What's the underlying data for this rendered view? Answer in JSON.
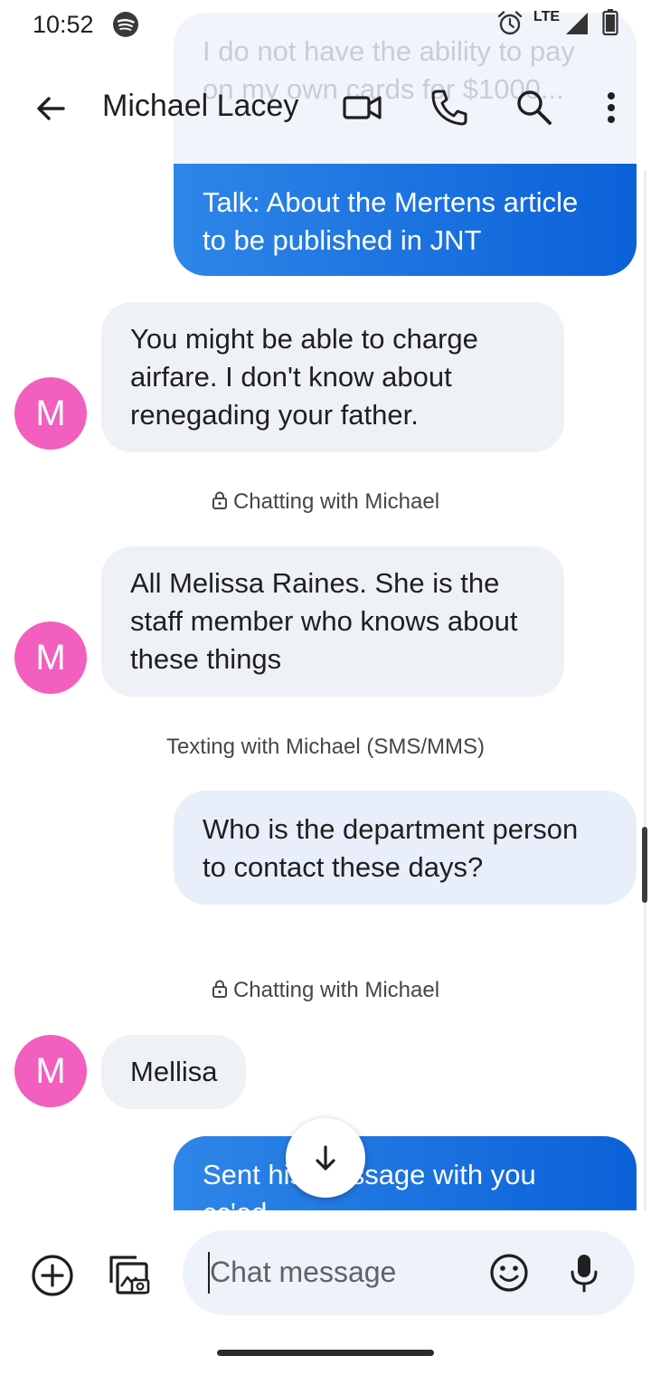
{
  "status_bar": {
    "time": "10:52",
    "network": "LTE",
    "icons": [
      "spotify-icon",
      "alarm-icon",
      "signal-icon",
      "battery-icon"
    ]
  },
  "header": {
    "contact_name": "Michael Lacey",
    "actions": [
      "back-arrow-icon",
      "video-call-icon",
      "phone-icon",
      "search-icon",
      "more-vert-icon"
    ]
  },
  "conversation": {
    "faded_message": "I do not have the ability to pay on my own cards for $1000...",
    "messages": [
      {
        "direction": "outgoing",
        "style": "rcs",
        "text": "Talk: About the Mertens article to be published in JNT"
      },
      {
        "direction": "incoming",
        "avatar": "M",
        "text": "You might be able to charge airfare. I don't know about renegading your father."
      },
      {
        "system": "Chatting with Michael"
      },
      {
        "direction": "incoming",
        "avatar": "M",
        "text": "All Melissa Raines. She is the staff member who knows about these things"
      },
      {
        "system": "Texting with Michael (SMS/MMS)"
      },
      {
        "direction": "outgoing",
        "style": "sms",
        "text": "Who is the department person to contact these days?"
      },
      {
        "system": "Chatting with Michael"
      },
      {
        "direction": "incoming",
        "avatar": "M",
        "text": "Mellisa"
      },
      {
        "direction": "outgoing",
        "style": "rcs",
        "text": "Sent his message with you cc'ed"
      }
    ]
  },
  "composer": {
    "placeholder": "Chat message",
    "icons": [
      "add-circle-icon",
      "gallery-icon",
      "emoji-icon",
      "mic-icon"
    ]
  },
  "colors": {
    "avatar": "#f25fbe",
    "rcs_bubble": "#1a73e8",
    "sms_bubble": "#e8eefa",
    "incoming_bubble": "#eef1f6"
  }
}
